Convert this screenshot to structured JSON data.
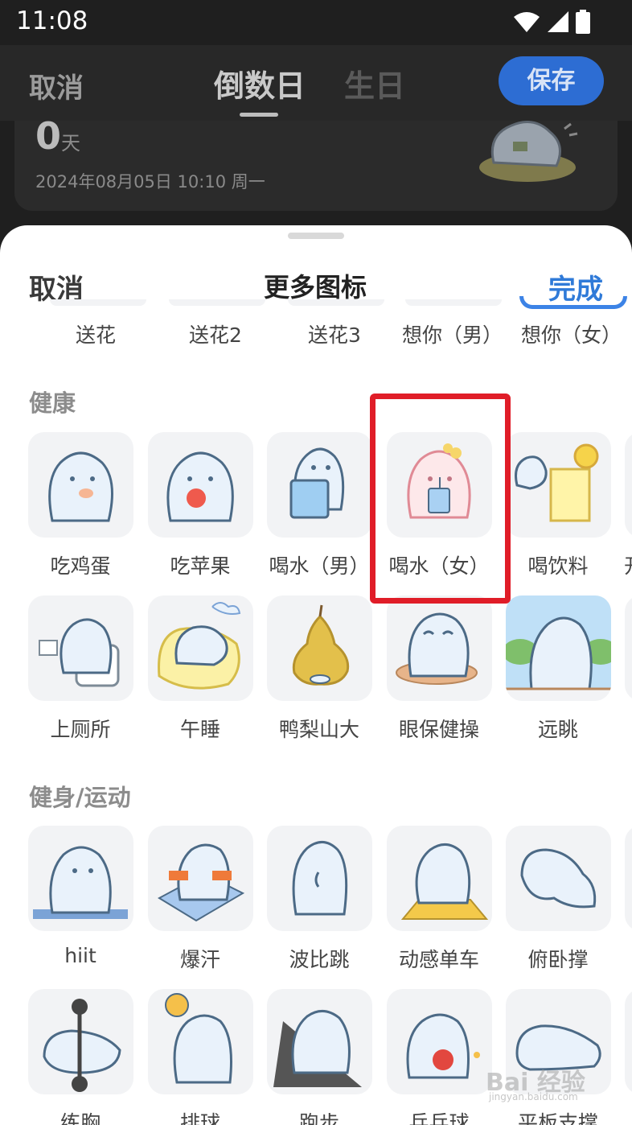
{
  "status_bar": {
    "time": "11:08"
  },
  "top_nav": {
    "cancel_label": "取消",
    "tab_countdown": "倒数日",
    "tab_birthday": "生日",
    "save_label": "保存"
  },
  "preview_card": {
    "days_value": "0",
    "days_unit": "天",
    "date_text": "2024年08月05日  10:10  周一"
  },
  "sheet": {
    "cancel_label": "取消",
    "title": "更多图标",
    "done_label": "完成",
    "top_row_labels": [
      "送花",
      "送花2",
      "送花3",
      "想你（男）",
      "想你（女）"
    ],
    "sections": [
      {
        "title": "健康",
        "rows": [
          [
            "吃鸡蛋",
            "吃苹果",
            "喝水（男）",
            "喝水（女）",
            "喝饮料"
          ],
          [
            "上厕所",
            "午睡",
            "鸭梨山大",
            "眼保健操",
            "远眺"
          ]
        ]
      },
      {
        "title": "健身/运动",
        "rows": [
          [
            "hiit",
            "爆汗",
            "波比跳",
            "动感单车",
            "俯卧撑"
          ],
          [
            "练胸",
            "排球",
            "跑步",
            "乒乓球",
            "平板支撑"
          ]
        ]
      }
    ],
    "selected_icon": "喝水（女）"
  },
  "colors": {
    "accent_blue": "#2f7ad8",
    "highlight_red": "#e01d28",
    "tile_bg": "#f2f3f5"
  },
  "watermark": {
    "text": "Bai 经验",
    "subtext": "jingyan.baidu.com"
  }
}
